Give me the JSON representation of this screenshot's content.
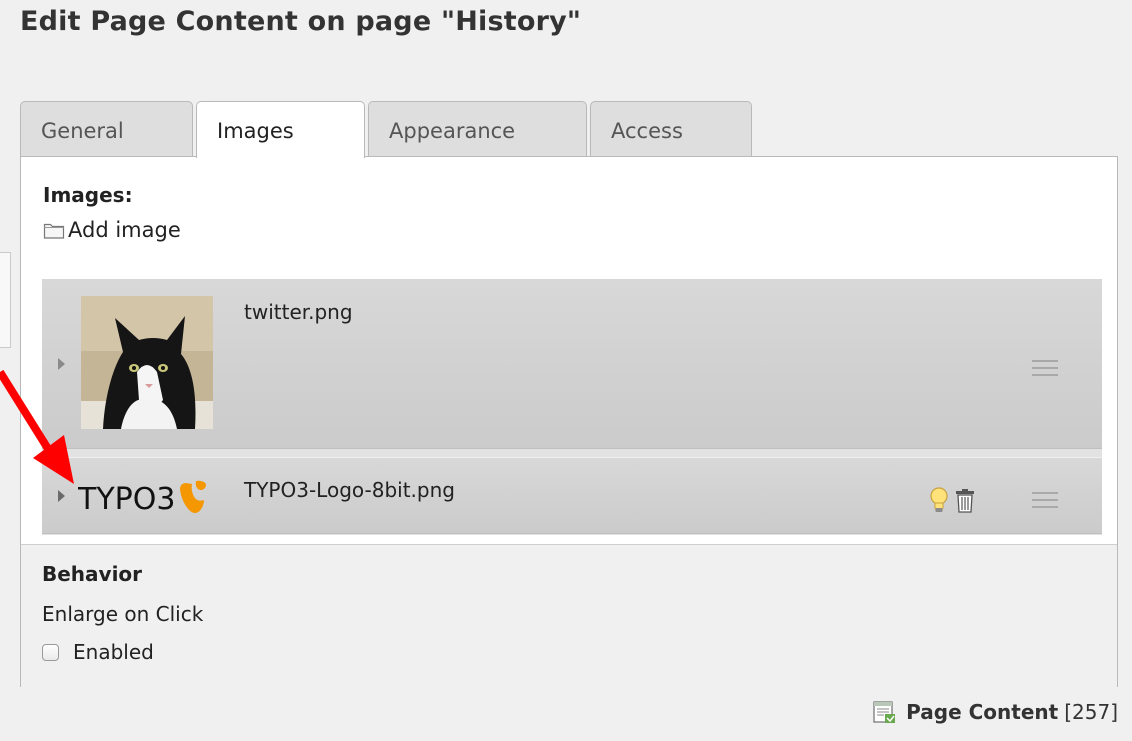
{
  "page": {
    "title": "Edit Page Content on page \"History\""
  },
  "tabs": [
    {
      "label": "General",
      "active": false
    },
    {
      "label": "Images",
      "active": true
    },
    {
      "label": "Appearance",
      "active": false
    },
    {
      "label": "Access",
      "active": false
    }
  ],
  "images_section": {
    "label": "Images:",
    "add_label": "Add image",
    "add_icon": "folder-icon",
    "items": [
      {
        "filename": "twitter.png",
        "thumbnail": "kitten-photo",
        "icons": [
          "expand-arrow-icon",
          "drag-handle-icon"
        ]
      },
      {
        "filename": "TYPO3-Logo-8bit.png",
        "thumbnail": "typo3-logo",
        "logo_text": "TYPO3",
        "icons": [
          "expand-arrow-icon",
          "lightbulb-icon",
          "trash-icon",
          "drag-handle-icon"
        ]
      }
    ]
  },
  "behavior": {
    "title": "Behavior",
    "enlarge_label": "Enlarge on Click",
    "checkbox_label": "Enabled",
    "checked": false
  },
  "footer": {
    "record_type": "Page Content",
    "record_id": "[257]",
    "icon": "page-content-icon"
  },
  "colors": {
    "annotation_arrow": "#ff0000",
    "typo3_orange": "#f49700",
    "panel_bg": "#ffffff",
    "page_bg": "#f0f0f0"
  }
}
